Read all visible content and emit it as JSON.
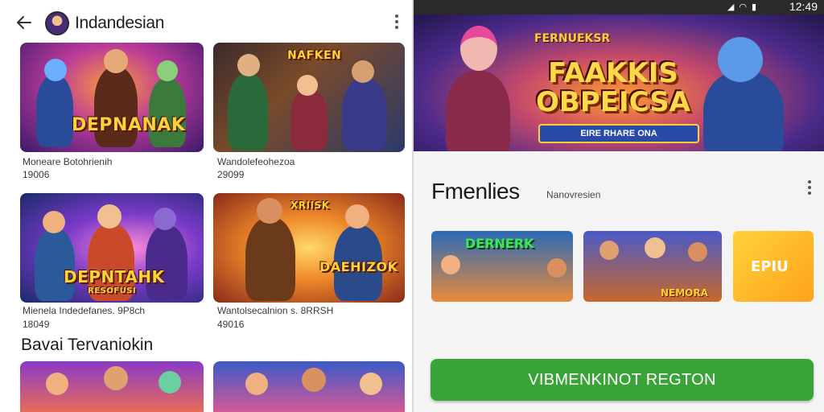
{
  "left": {
    "header": {
      "title": "Indandesian",
      "back_icon": "arrow-left-icon",
      "menu_icon": "more-vert-icon"
    },
    "cards": [
      {
        "banner": "DEPNANAK",
        "banner_sub": "",
        "name": "Moneare Botohrienih",
        "meta": "19006"
      },
      {
        "banner": "NAFKEN",
        "banner_sub": "",
        "name": "Wandolefeohezoa",
        "meta": "29099"
      },
      {
        "banner": "DEPNTAHK",
        "banner_sub": "RESOFUSI",
        "name": "Mienela Indedefanes. 9P8ch",
        "meta": "18049"
      },
      {
        "banner": "DAEHIZOK",
        "banner_sub": "XRIISK",
        "name": "Wantolsecalnion s. 8RRSH",
        "meta": "49016"
      }
    ],
    "section_title": "Bavai Tervaniokin"
  },
  "right": {
    "status": {
      "time": "12:49"
    },
    "hero": {
      "top_text": "FERNUEKSR",
      "title_line1": "FAAKKIS",
      "title_line2": "OBPEICSA",
      "ribbon": "EIRE RHARE ONA"
    },
    "heading": "Fmenlies",
    "subheading": "Nanovresien",
    "thumbs": [
      {
        "text": "DERNERK"
      },
      {
        "text": "NEMORA"
      },
      {
        "text": "EPIU"
      }
    ],
    "cta_label": "VIBMENKINOT REGTON"
  },
  "colors": {
    "cta": "#3aa33a",
    "banner_gold": "#ffd23a",
    "statusbar": "#2a2a2a"
  }
}
